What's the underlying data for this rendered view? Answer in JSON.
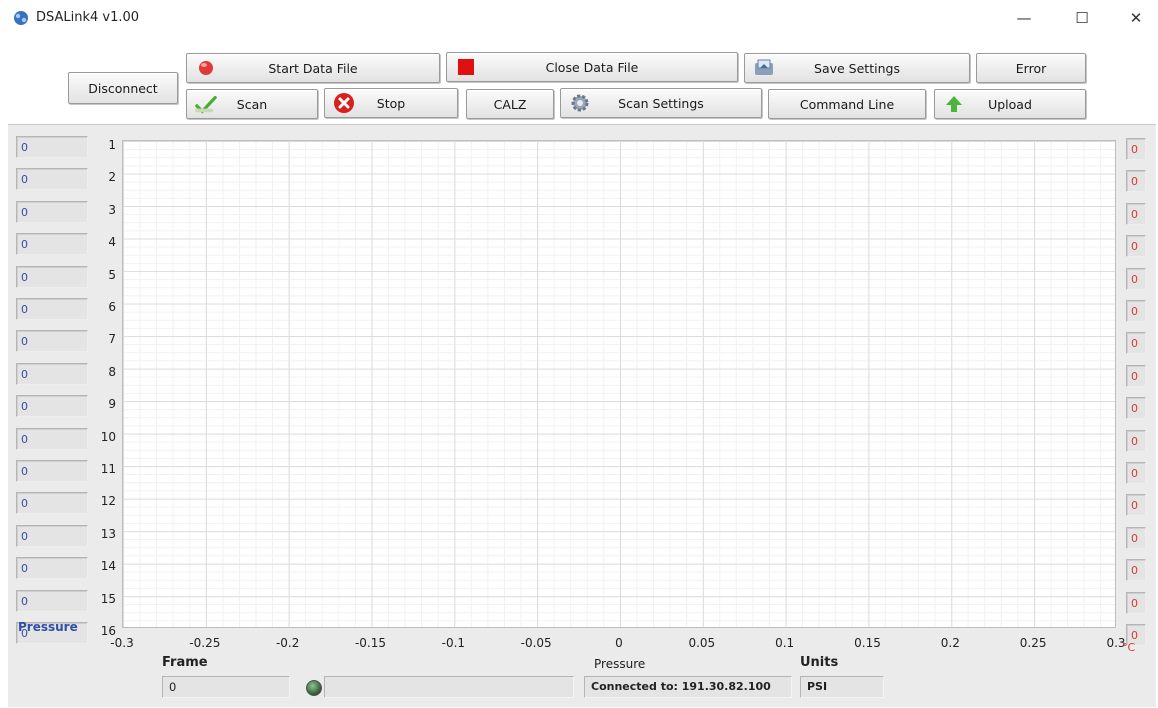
{
  "window": {
    "title": "DSALink4 v1.00",
    "controls": {
      "minimize": "—",
      "maximize": "☐",
      "close": "✕"
    }
  },
  "toolbar": {
    "disconnect": "Disconnect",
    "start_data_file": "Start Data File",
    "close_data_file": "Close Data File",
    "save_settings": "Save Settings",
    "error": "Error",
    "scan": "Scan",
    "stop": "Stop",
    "calz": "CALZ",
    "scan_settings": "Scan Settings",
    "command_line": "Command Line",
    "upload": "Upload"
  },
  "left_values": [
    "0",
    "0",
    "0",
    "0",
    "0",
    "0",
    "0",
    "0",
    "0",
    "0",
    "0",
    "0",
    "0",
    "0",
    "0",
    "0"
  ],
  "right_values": [
    "0",
    "0",
    "0",
    "0",
    "0",
    "0",
    "0",
    "0",
    "0",
    "0",
    "0",
    "0",
    "0",
    "0",
    "0",
    "0"
  ],
  "chart": {
    "y_ticks": [
      "1",
      "2",
      "3",
      "4",
      "5",
      "6",
      "7",
      "8",
      "9",
      "10",
      "11",
      "12",
      "13",
      "14",
      "15",
      "16"
    ],
    "x_ticks": [
      "-0.3",
      "-0.25",
      "-0.2",
      "-0.15",
      "-0.1",
      "-0.05",
      "0",
      "0.05",
      "0.1",
      "0.15",
      "0.2",
      "0.25",
      "0.3"
    ],
    "x_axis_label": "Pressure",
    "left_label": "Pressure",
    "temp_unit": "°C"
  },
  "chart_data": {
    "type": "bar",
    "categories": [
      "1",
      "2",
      "3",
      "4",
      "5",
      "6",
      "7",
      "8",
      "9",
      "10",
      "11",
      "12",
      "13",
      "14",
      "15",
      "16"
    ],
    "values": [
      0,
      0,
      0,
      0,
      0,
      0,
      0,
      0,
      0,
      0,
      0,
      0,
      0,
      0,
      0,
      0
    ],
    "xlabel": "Pressure",
    "ylabel": "",
    "xlim": [
      -0.3,
      0.3
    ],
    "grid": true
  },
  "footer": {
    "frame_label": "Frame",
    "frame_value": "0",
    "status_text": "Connected to: 191.30.82.100",
    "units_label": "Units",
    "units_value": "PSI"
  }
}
